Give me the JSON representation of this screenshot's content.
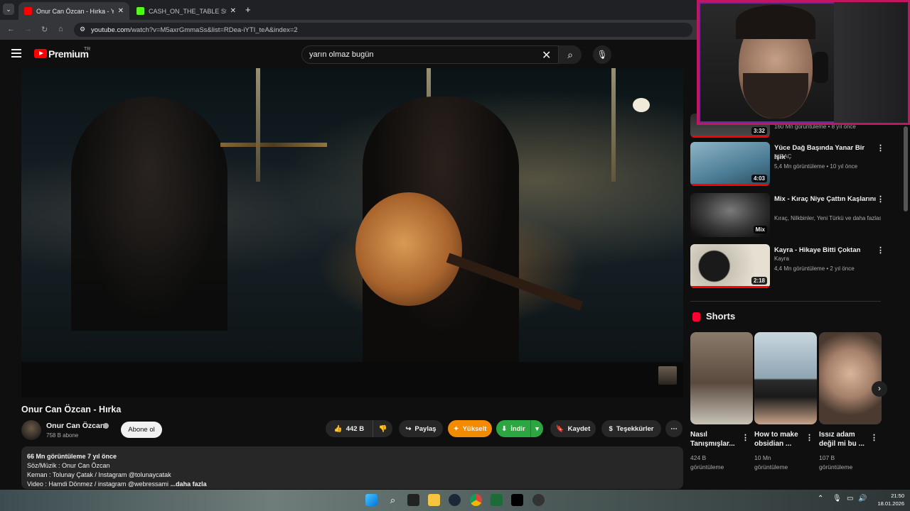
{
  "browser": {
    "tabs": [
      {
        "title": "Onur Can Özcan - Hırka - YouT",
        "favicon_color": "#ff0000",
        "active": true
      },
      {
        "title": "CASH_ON_THE_TABLE Stream -",
        "favicon_color": "#53fc18",
        "active": false
      }
    ],
    "url_host": "youtube.com",
    "url_path": "/watch?v=M5axrGmmaSs&list=RDea-iYTI_teA&index=2"
  },
  "youtube": {
    "logo_text": "Premium",
    "country_code": "TR",
    "search_value": "yarın olmaz bugün"
  },
  "video": {
    "title": "Onur Can Özcan - Hırka",
    "channel": "Onur Can Özcan",
    "subscribers": "758 B abone",
    "subscribe_label": "Abone ol",
    "likes": "442 B",
    "share_label": "Paylaş",
    "boost_label": "Yükselt",
    "download_label": "İndir",
    "save_label": "Kaydet",
    "thanks_label": "Teşekkürler",
    "description": {
      "meta": "66 Mn görüntüleme  7 yıl önce",
      "line1": "Söz/Müzik : Onur Can Özcan",
      "line2": "Keman : Tolunay Çatak / Instagram @tolunaycatak",
      "line3": "Video : Hamdi Dönmez / instagram @webressami",
      "more": "...daha fazla"
    }
  },
  "recommended": [
    {
      "title": "",
      "channel": "",
      "meta": "160 Mn görüntüleme • 8 yıl önce",
      "duration": "3:32"
    },
    {
      "title": "Yüce Dağ Başında Yanar Bir Işık",
      "channel": "KIRAÇ",
      "meta": "5,4 Mn görüntüleme • 10 yıl önce",
      "duration": "4:03"
    },
    {
      "title": "Mix - Kıraç   Niye Çattın Kaşlarını",
      "channel": "Kıraç, Nilkbinler, Yeni Türkü ve daha fazlası",
      "meta": "",
      "duration": "Mix"
    },
    {
      "title": "Kayra - Hikaye Bitti Çoktan",
      "channel": "Kayra",
      "meta": "4,4 Mn görüntüleme • 2 yıl önce",
      "duration": "2:18"
    }
  ],
  "shorts": {
    "heading": "Shorts",
    "items": [
      {
        "title": "Nasıl Tanışmışlar...",
        "views": "424 B",
        "views_label": "görüntüleme"
      },
      {
        "title": "How to make obsidian ...",
        "views": "10 Mn",
        "views_label": "görüntüleme"
      },
      {
        "title": "Issız adam değil mi bu ...",
        "views": "107 B",
        "views_label": "görüntüleme"
      }
    ]
  },
  "taskbar": {
    "time": "21:50",
    "date": "18.01.2026"
  },
  "colors": {
    "accent_red": "#ff0000",
    "boost_orange": "#f28b00",
    "download_green": "#2ba640",
    "webcam_border": "#c01760"
  }
}
